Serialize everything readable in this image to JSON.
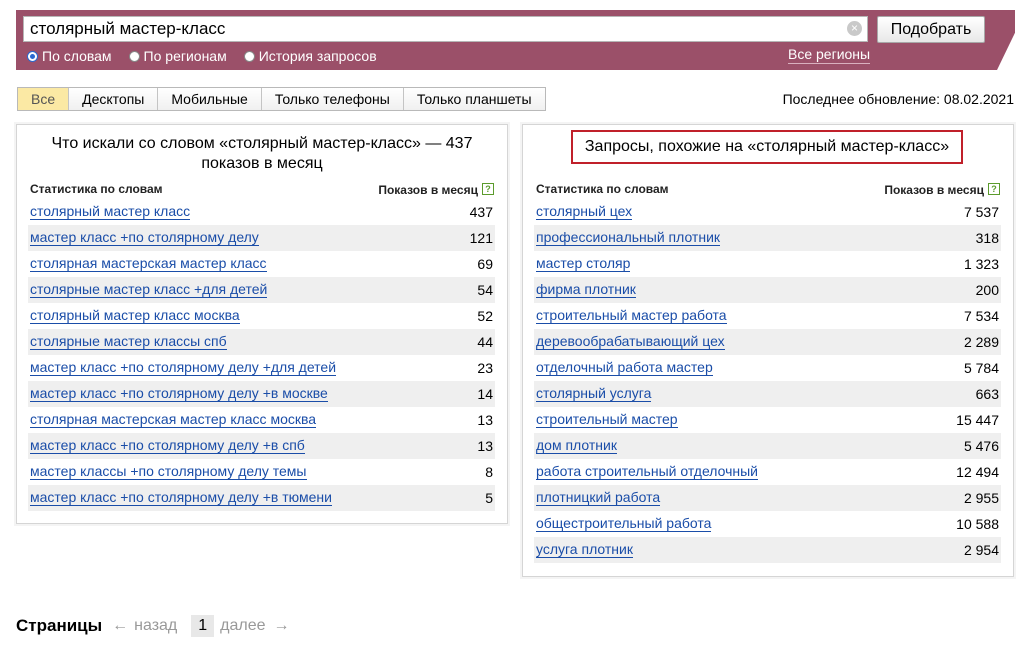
{
  "search": {
    "query": "столярный мастер-класс",
    "clear_symbol": "×",
    "submit_label": "Подобрать",
    "radios": [
      {
        "label": "По словам",
        "checked": true
      },
      {
        "label": "По регионам",
        "checked": false
      },
      {
        "label": "История запросов",
        "checked": false
      }
    ],
    "all_regions": "Все регионы"
  },
  "tabs": [
    "Все",
    "Десктопы",
    "Мобильные",
    "Только телефоны",
    "Только планшеты"
  ],
  "last_update": "Последнее обновление: 08.02.2021",
  "left_panel": {
    "title": "Что искали со словом «столярный мастер-класс» — 437 показов в месяц",
    "col_left": "Статистика по словам",
    "col_right": "Показов в месяц",
    "help": "?",
    "rows": [
      {
        "phrase": "столярный мастер класс",
        "count": "437"
      },
      {
        "phrase": "мастер класс +по столярному делу",
        "count": "121"
      },
      {
        "phrase": "столярная мастерская мастер класс",
        "count": "69"
      },
      {
        "phrase": "столярные мастер класс +для детей",
        "count": "54"
      },
      {
        "phrase": "столярный мастер класс москва",
        "count": "52"
      },
      {
        "phrase": "столярные мастер классы спб",
        "count": "44"
      },
      {
        "phrase": "мастер класс +по столярному делу +для детей",
        "count": "23"
      },
      {
        "phrase": "мастер класс +по столярному делу +в москве",
        "count": "14"
      },
      {
        "phrase": "столярная мастерская мастер класс москва",
        "count": "13"
      },
      {
        "phrase": "мастер класс +по столярному делу +в спб",
        "count": "13"
      },
      {
        "phrase": "мастер классы +по столярному делу темы",
        "count": "8"
      },
      {
        "phrase": "мастер класс +по столярному делу +в тюмени",
        "count": "5"
      }
    ]
  },
  "right_panel": {
    "title": "Запросы, похожие на «столярный мастер-класс»",
    "col_left": "Статистика по словам",
    "col_right": "Показов в месяц",
    "help": "?",
    "rows": [
      {
        "phrase": "столярный цех",
        "count": "7 537"
      },
      {
        "phrase": "профессиональный плотник",
        "count": "318"
      },
      {
        "phrase": "мастер столяр",
        "count": "1 323"
      },
      {
        "phrase": "фирма плотник",
        "count": "200"
      },
      {
        "phrase": "строительный мастер работа",
        "count": "7 534"
      },
      {
        "phrase": "деревообрабатывающий цех",
        "count": "2 289"
      },
      {
        "phrase": "отделочный работа мастер",
        "count": "5 784"
      },
      {
        "phrase": "столярный услуга",
        "count": "663"
      },
      {
        "phrase": "строительный мастер",
        "count": "15 447"
      },
      {
        "phrase": "дом плотник",
        "count": "5 476"
      },
      {
        "phrase": "работа строительный отделочный",
        "count": "12 494"
      },
      {
        "phrase": "плотницкий работа",
        "count": "2 955"
      },
      {
        "phrase": "общестроительный работа",
        "count": "10 588"
      },
      {
        "phrase": "услуга плотник",
        "count": "2 954"
      }
    ]
  },
  "pager": {
    "label": "Страницы",
    "prev_arrow": "←",
    "prev": "назад",
    "current": "1",
    "next": "далее",
    "next_arrow": "→"
  },
  "colors": {
    "header_band": "#9b5069",
    "link": "#1a4da8",
    "active_tab": "#fbe9a4",
    "highlight_border": "#c0202a"
  }
}
